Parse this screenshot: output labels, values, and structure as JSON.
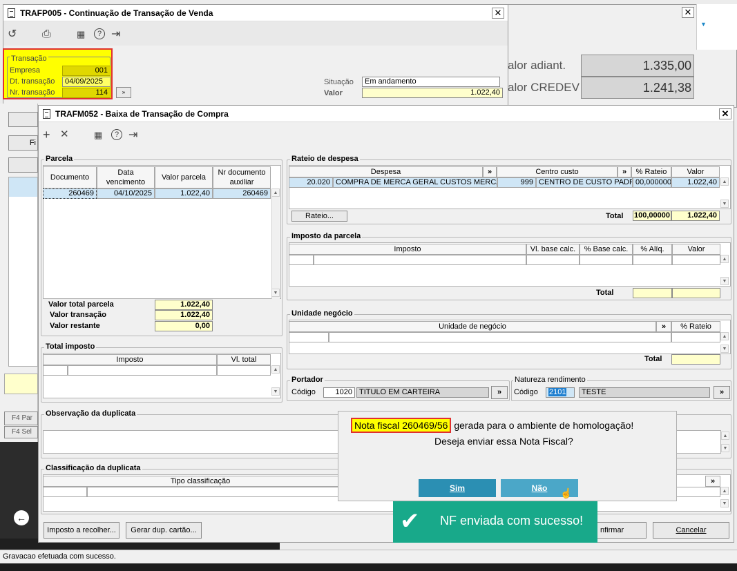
{
  "back_window": {
    "title": "TRAFP005 - Continuação de Transação de Venda",
    "transacao_group": "Transação",
    "empresa_label": "Empresa",
    "empresa_value": "001",
    "dt_label": "Dt. transação",
    "dt_value": "04/09/2025",
    "nr_label": "Nr. transação",
    "nr_value": "114",
    "situacao_label": "Situação",
    "situacao_value": "Em andamento",
    "valor_label": "Valor",
    "valor_value": "1.022,40"
  },
  "right_window": {
    "adiant_label": "alor adiant.",
    "adiant_value": "1.335,00",
    "credev_label": "alor CREDEV",
    "credev_value": "1.241,38"
  },
  "left_fragments": {
    "fi": "Fi",
    "f4_par": "F4 Par",
    "f4_sel": "F4 Sel"
  },
  "main": {
    "title": "TRAFM052 - Baixa de Transação de Compra",
    "parcela": {
      "title": "Parcela",
      "headers": [
        "Documento",
        "Data vencimento",
        "Valor parcela",
        "Nr documento auxiliar"
      ],
      "row": [
        "260469",
        "04/10/2025",
        "1.022,40",
        "260469"
      ],
      "total_label": "Valor total parcela",
      "total_value": "1.022,40",
      "transacao_label": "Valor transação",
      "transacao_value": "1.022,40",
      "restante_label": "Valor restante",
      "restante_value": "0,00"
    },
    "total_imposto": {
      "title": "Total imposto",
      "headers": [
        "Imposto",
        "Vl. total"
      ]
    },
    "rateio": {
      "title": "Rateio de despesa",
      "headers": [
        "Despesa",
        "»",
        "Centro custo",
        "»",
        "% Rateio",
        "Valor"
      ],
      "row": [
        "20.020",
        "COMPRA DE MERCA GERAL CUSTOS MERCADO",
        "999",
        "CENTRO DE CUSTO PADRÃO",
        "00,000000",
        "1.022,40"
      ],
      "button": "Rateio...",
      "total_label": "Total",
      "total_pct": "100,00000",
      "total_value": "1.022,40"
    },
    "imposto_parcela": {
      "title": "Imposto da parcela",
      "headers": [
        "Imposto",
        "Vl. base calc.",
        "% Base calc.",
        "% Alíq.",
        "Valor"
      ],
      "total_label": "Total"
    },
    "unidade": {
      "title": "Unidade negócio",
      "headers": [
        "Unidade de negócio",
        "»",
        "% Rateio"
      ],
      "total_label": "Total"
    },
    "portador": {
      "title": "Portador",
      "codigo_label": "Código",
      "codigo": "1020",
      "nome": "TITULO EM CARTEIRA",
      "btn": "»"
    },
    "natureza": {
      "title": "Natureza rendimento",
      "codigo_label": "Código",
      "codigo": "2101",
      "nome": "TESTE",
      "btn": "»"
    },
    "observacao": {
      "title": "Observação da duplicata"
    },
    "classificacao": {
      "title": "Classificação da duplicata",
      "header": "Tipo classificação",
      "btn": "»"
    },
    "buttons": {
      "imposto": "Imposto a recolher...",
      "gerar": "Gerar dup. cartão...",
      "confirmar": "Confirmar",
      "confirmar_visible": "nfirmar",
      "cancelar": "Cancelar"
    }
  },
  "dialog": {
    "highlight": "Nota fiscal 260469/56",
    "line1_rest": " gerada para o ambiente de homologação!",
    "line2": "Deseja enviar essa Nota Fiscal?",
    "sim": "Sim",
    "nao": "Não"
  },
  "toast": {
    "text": "NF enviada com sucesso!"
  },
  "status_bar": {
    "text": "Gravacao efetuada com sucesso."
  },
  "colors": {
    "highlight": "#ffff00",
    "yellow_field": "#ffffcc",
    "dialog_button": "#2b8fb3",
    "toast": "#18a98a",
    "selection": "#cfe6f6"
  }
}
